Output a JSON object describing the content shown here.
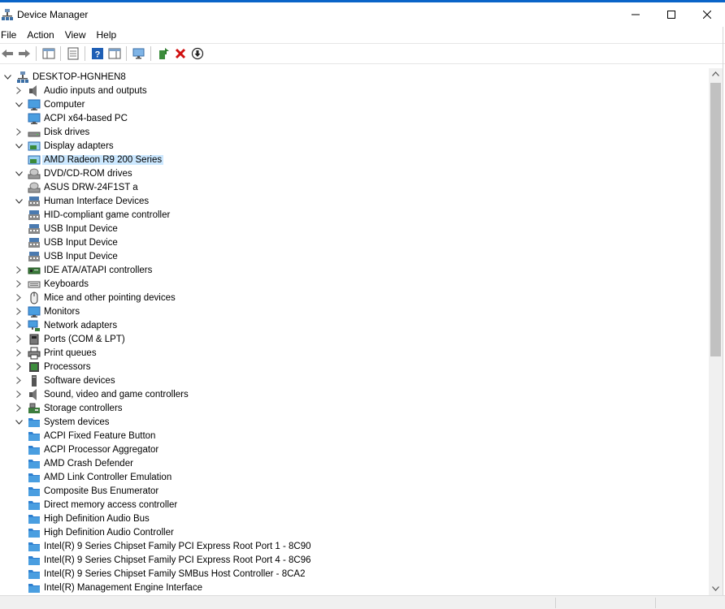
{
  "window": {
    "title": "Device Manager",
    "minimize": "—",
    "maximize": "☐",
    "close": "✕"
  },
  "menu": [
    "File",
    "Action",
    "View",
    "Help"
  ],
  "colors": {
    "selection": "#cce8ff",
    "accent": "#0a64c8"
  },
  "toolbar": [
    {
      "name": "back-arrow-icon"
    },
    {
      "name": "forward-arrow-icon"
    },
    {
      "name": "sep"
    },
    {
      "name": "show-hide-console-tree-icon"
    },
    {
      "name": "sep"
    },
    {
      "name": "properties-icon"
    },
    {
      "name": "sep"
    },
    {
      "name": "help-icon"
    },
    {
      "name": "show-action-pane-icon"
    },
    {
      "name": "sep"
    },
    {
      "name": "scan-hardware-changes-icon"
    },
    {
      "name": "sep"
    },
    {
      "name": "update-driver-icon"
    },
    {
      "name": "uninstall-device-icon"
    },
    {
      "name": "download-icon"
    }
  ],
  "tree": [
    {
      "label": "DESKTOP-HGNHEN8",
      "level": 0,
      "expand": "open",
      "icon": "computer-root-icon"
    },
    {
      "label": "Audio inputs and outputs",
      "level": 1,
      "expand": "closed",
      "icon": "speaker-icon"
    },
    {
      "label": "Computer",
      "level": 1,
      "expand": "open",
      "icon": "monitor-icon"
    },
    {
      "label": "ACPI x64-based PC",
      "level": 2,
      "expand": "none",
      "icon": "monitor-icon"
    },
    {
      "label": "Disk drives",
      "level": 1,
      "expand": "closed",
      "icon": "disk-drive-icon"
    },
    {
      "label": "Display adapters",
      "level": 1,
      "expand": "open",
      "icon": "display-adapter-icon"
    },
    {
      "label": "AMD Radeon R9 200 Series",
      "level": 2,
      "expand": "none",
      "icon": "display-adapter-icon",
      "selected": true
    },
    {
      "label": "DVD/CD-ROM drives",
      "level": 1,
      "expand": "open",
      "icon": "dvd-drive-icon"
    },
    {
      "label": "ASUS DRW-24F1ST   a",
      "level": 2,
      "expand": "none",
      "icon": "dvd-drive-icon"
    },
    {
      "label": "Human Interface Devices",
      "level": 1,
      "expand": "open",
      "icon": "hid-icon"
    },
    {
      "label": "HID-compliant game controller",
      "level": 2,
      "expand": "none",
      "icon": "hid-icon"
    },
    {
      "label": "USB Input Device",
      "level": 2,
      "expand": "none",
      "icon": "hid-icon"
    },
    {
      "label": "USB Input Device",
      "level": 2,
      "expand": "none",
      "icon": "hid-icon"
    },
    {
      "label": "USB Input Device",
      "level": 2,
      "expand": "none",
      "icon": "hid-icon"
    },
    {
      "label": "IDE ATA/ATAPI controllers",
      "level": 1,
      "expand": "closed",
      "icon": "ide-controller-icon"
    },
    {
      "label": "Keyboards",
      "level": 1,
      "expand": "closed",
      "icon": "keyboard-icon"
    },
    {
      "label": "Mice and other pointing devices",
      "level": 1,
      "expand": "closed",
      "icon": "mouse-icon"
    },
    {
      "label": "Monitors",
      "level": 1,
      "expand": "closed",
      "icon": "monitor-icon"
    },
    {
      "label": "Network adapters",
      "level": 1,
      "expand": "closed",
      "icon": "network-adapter-icon"
    },
    {
      "label": "Ports (COM & LPT)",
      "level": 1,
      "expand": "closed",
      "icon": "port-icon"
    },
    {
      "label": "Print queues",
      "level": 1,
      "expand": "closed",
      "icon": "printer-icon"
    },
    {
      "label": "Processors",
      "level": 1,
      "expand": "closed",
      "icon": "processor-icon"
    },
    {
      "label": "Software devices",
      "level": 1,
      "expand": "closed",
      "icon": "software-device-icon"
    },
    {
      "label": "Sound, video and game controllers",
      "level": 1,
      "expand": "closed",
      "icon": "speaker-icon"
    },
    {
      "label": "Storage controllers",
      "level": 1,
      "expand": "closed",
      "icon": "storage-controller-icon"
    },
    {
      "label": "System devices",
      "level": 1,
      "expand": "open",
      "icon": "system-folder-icon"
    },
    {
      "label": "ACPI Fixed Feature Button",
      "level": 2,
      "expand": "none",
      "icon": "system-folder-icon"
    },
    {
      "label": "ACPI Processor Aggregator",
      "level": 2,
      "expand": "none",
      "icon": "system-folder-icon"
    },
    {
      "label": "AMD Crash Defender",
      "level": 2,
      "expand": "none",
      "icon": "system-folder-icon"
    },
    {
      "label": "AMD Link Controller Emulation",
      "level": 2,
      "expand": "none",
      "icon": "system-folder-icon"
    },
    {
      "label": "Composite Bus Enumerator",
      "level": 2,
      "expand": "none",
      "icon": "system-folder-icon"
    },
    {
      "label": "Direct memory access controller",
      "level": 2,
      "expand": "none",
      "icon": "system-folder-icon"
    },
    {
      "label": "High Definition Audio Bus",
      "level": 2,
      "expand": "none",
      "icon": "system-folder-icon"
    },
    {
      "label": "High Definition Audio Controller",
      "level": 2,
      "expand": "none",
      "icon": "system-folder-icon"
    },
    {
      "label": "Intel(R) 9 Series Chipset Family PCI Express Root Port 1 - 8C90",
      "level": 2,
      "expand": "none",
      "icon": "system-folder-icon"
    },
    {
      "label": "Intel(R) 9 Series Chipset Family PCI Express Root Port 4 - 8C96",
      "level": 2,
      "expand": "none",
      "icon": "system-folder-icon"
    },
    {
      "label": "Intel(R) 9 Series Chipset Family SMBus Host Controller - 8CA2",
      "level": 2,
      "expand": "none",
      "icon": "system-folder-icon"
    },
    {
      "label": "Intel(R) Management Engine Interface",
      "level": 2,
      "expand": "none",
      "icon": "system-folder-icon"
    }
  ]
}
